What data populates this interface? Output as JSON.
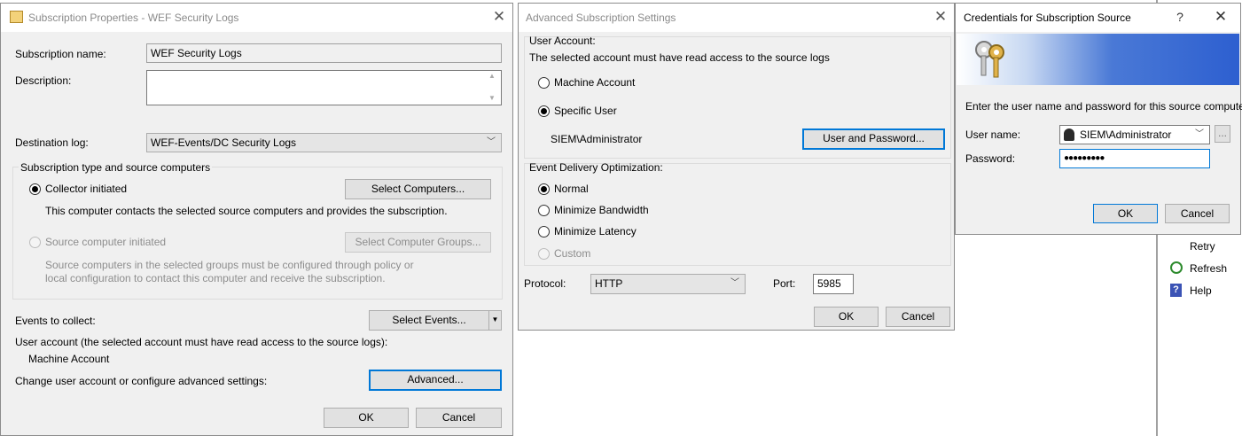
{
  "sub_props": {
    "title": "Subscription Properties - WEF Security Logs",
    "name_label": "Subscription name:",
    "name_value": "WEF Security Logs",
    "desc_label": "Description:",
    "desc_value": "",
    "dest_label": "Destination log:",
    "dest_value": "WEF-Events/DC Security Logs",
    "type_group": "Subscription type and source computers",
    "collector_label": "Collector initiated",
    "select_computers": "Select Computers...",
    "collector_desc": "This computer contacts the selected source computers and provides the subscription.",
    "source_label": "Source computer initiated",
    "select_groups": "Select Computer Groups...",
    "source_desc_1": "Source computers in the selected groups must be configured through policy or",
    "source_desc_2": "local configuration to contact this computer and receive the subscription.",
    "events_label": "Events to collect:",
    "select_events": "Select Events...",
    "user_account_label": "User account (the selected account must have read access to the source logs):",
    "user_account_value": "Machine Account",
    "change_label": "Change user account or configure advanced settings:",
    "advanced": "Advanced...",
    "ok": "OK",
    "cancel": "Cancel"
  },
  "adv": {
    "title": "Advanced Subscription Settings",
    "user_account_header": "User Account:",
    "user_account_note": "The selected account must have read access to the source logs",
    "machine_account": "Machine Account",
    "specific_user": "Specific User",
    "user_value": "SIEM\\Administrator",
    "user_and_password": "User and Password...",
    "delivery_header": "Event Delivery Optimization:",
    "normal": "Normal",
    "min_bandwidth": "Minimize Bandwidth",
    "min_latency": "Minimize Latency",
    "custom": "Custom",
    "protocol_label": "Protocol:",
    "protocol_value": "HTTP",
    "port_label": "Port:",
    "port_value": "5985",
    "ok": "OK",
    "cancel": "Cancel"
  },
  "cred": {
    "title": "Credentials for Subscription Source",
    "help": "?",
    "prompt": "Enter the user name and password for this source computer:",
    "username_label": "User name:",
    "username_value": "SIEM\\Administrator",
    "password_label": "Password:",
    "password_value": "●●●●●●●●●",
    "browse": "...",
    "ok": "OK",
    "cancel": "Cancel"
  },
  "actions": {
    "retry": "Retry",
    "refresh": "Refresh",
    "help": "Help"
  },
  "colors": {
    "accent": "#0078d7",
    "window_bg": "#f0f0f0"
  }
}
